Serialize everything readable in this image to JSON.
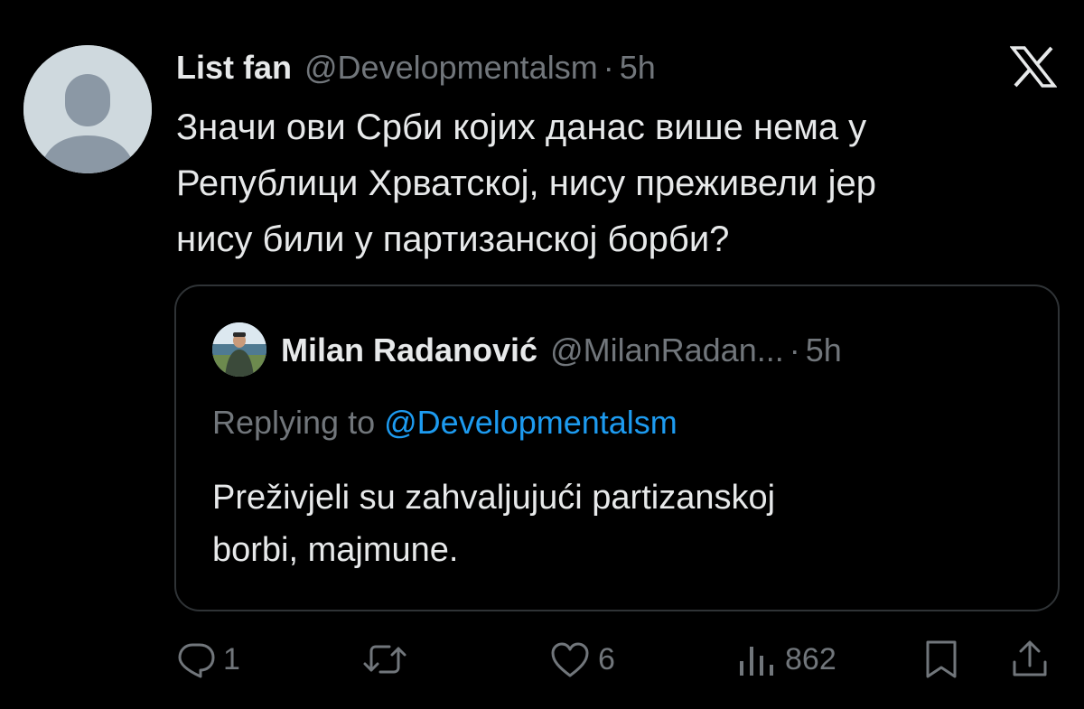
{
  "tweet": {
    "display_name": "List fan",
    "handle": "@Developmentalsm",
    "separator": "·",
    "time": "5h",
    "text_lines": [
      "Значи ови Срби којих данас више нема у",
      "Републици Хрватској, нису преживели јер",
      "нису били у партизанској борби?"
    ]
  },
  "quote": {
    "display_name": "Milan Radanović",
    "handle": "@MilanRadan...",
    "separator": "·",
    "time": "5h",
    "replying_prefix": "Replying to",
    "replying_handle": "@Developmentalsm",
    "text_lines": [
      "Preživjeli su zahvaljujući partizanskoj",
      "borbi, majmune."
    ]
  },
  "actions": {
    "reply_count": "1",
    "like_count": "6",
    "views_count": "862"
  },
  "icons": {
    "logo": "x-logo-icon",
    "reply": "reply-icon",
    "retweet": "retweet-icon",
    "like": "heart-icon",
    "views": "views-icon",
    "bookmark": "bookmark-icon",
    "share": "share-icon"
  },
  "colors": {
    "background": "#000000",
    "text_primary": "#e7e9ea",
    "text_secondary": "#71767b",
    "link": "#1d9bf0",
    "border": "#2f3336"
  }
}
